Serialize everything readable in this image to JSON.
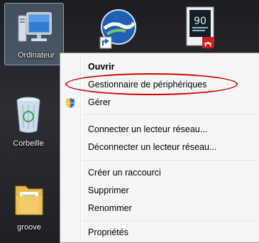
{
  "desktop": {
    "icons": [
      {
        "label": "Ordinateur",
        "icon": "computer-icon"
      },
      {
        "label": "",
        "icon": "google-earth-icon"
      },
      {
        "label": "",
        "icon": "pdf-document-icon"
      },
      {
        "label": "Corbeille",
        "icon": "recycle-bin-icon"
      },
      {
        "label": "groove",
        "icon": "folder-icon"
      }
    ]
  },
  "context_menu": {
    "items": [
      {
        "label": "Ouvrir",
        "bold": true
      },
      {
        "label": "Gestionnaire de périphériques",
        "highlighted": true
      },
      {
        "label": "Gérer",
        "icon": "uac-shield-icon"
      },
      {
        "label": "Connecter un lecteur réseau..."
      },
      {
        "label": "Déconnecter un lecteur réseau..."
      },
      {
        "label": "Créer un raccourci"
      },
      {
        "label": "Supprimer"
      },
      {
        "label": "Renommer"
      },
      {
        "label": "Propriétés"
      }
    ]
  },
  "colors": {
    "highlight_ring": "#d40000",
    "menu_background": "#f5f6f7"
  }
}
